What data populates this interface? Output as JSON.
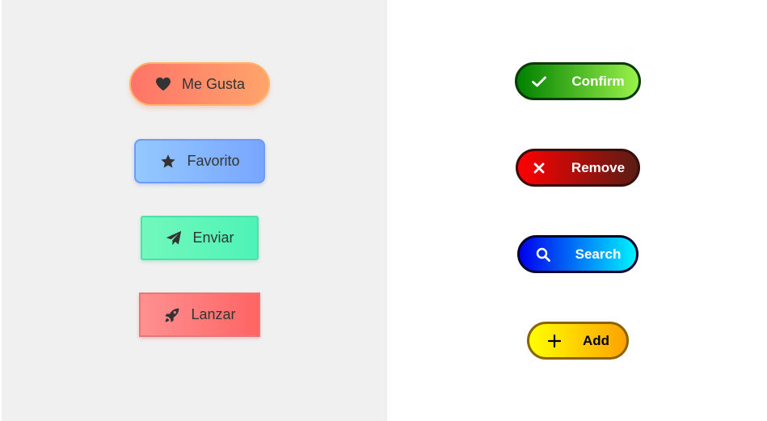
{
  "left_panel": {
    "background": "#f0f0f0",
    "buttons": [
      {
        "label": "Me Gusta",
        "icon": "heart-icon"
      },
      {
        "label": "Favorito",
        "icon": "star-icon"
      },
      {
        "label": "Enviar",
        "icon": "paper-plane-icon"
      },
      {
        "label": "Lanzar",
        "icon": "rocket-icon"
      }
    ]
  },
  "right_panel": {
    "background": "#ffffff",
    "buttons": [
      {
        "label": "Confirm",
        "icon": "check-icon",
        "colors": [
          "#008000",
          "#9af24a"
        ]
      },
      {
        "label": "Remove",
        "icon": "close-icon",
        "colors": [
          "#ff0000",
          "#5a1d14"
        ]
      },
      {
        "label": "Search",
        "icon": "search-icon",
        "colors": [
          "#0000ee",
          "#00f2ff"
        ]
      },
      {
        "label": "Add",
        "icon": "plus-icon",
        "colors": [
          "#ffff00",
          "#ffa200"
        ]
      }
    ]
  }
}
